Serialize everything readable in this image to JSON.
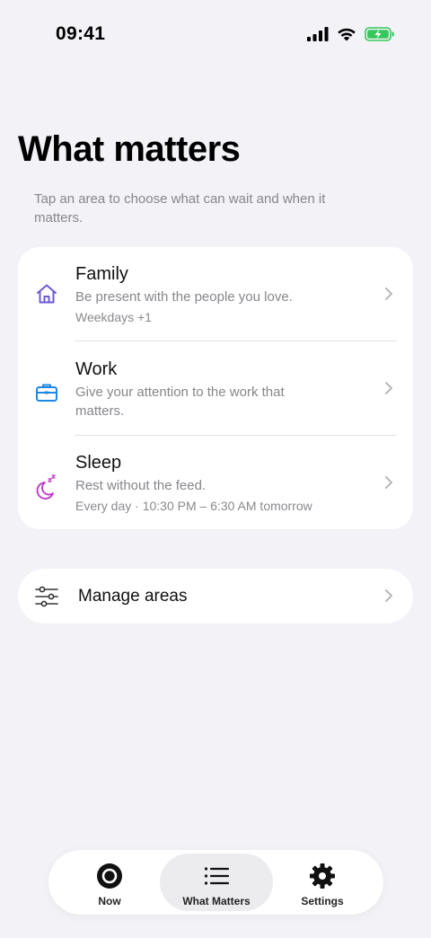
{
  "status_bar": {
    "time": "09:41",
    "icons": [
      "cellular-signal-icon",
      "wifi-icon",
      "battery-charging-icon"
    ],
    "battery_color": "#34c759"
  },
  "header": {
    "title": "What matters",
    "subtitle": "Tap an area to choose what can wait and when it matters."
  },
  "areas": [
    {
      "icon": "home-icon",
      "icon_color": "#6b5bd6",
      "title": "Family",
      "description": "Be present with the people you love.",
      "meta": "Weekdays +1"
    },
    {
      "icon": "briefcase-icon",
      "icon_color": "#1e88e5",
      "title": "Work",
      "description": "Give your attention to the work that matters.",
      "meta": ""
    },
    {
      "icon": "moon-sleep-icon",
      "icon_color": "#c034c8",
      "title": "Sleep",
      "description": "Rest without the feed.",
      "meta": "Every day · 10:30 PM – 6:30 AM tomorrow"
    }
  ],
  "manage": {
    "icon": "sliders-icon",
    "label": "Manage areas"
  },
  "tab_bar": {
    "tabs": [
      {
        "icon": "circle-icon",
        "label": "Now",
        "selected": false
      },
      {
        "icon": "list-icon",
        "label": "What Matters",
        "selected": true
      },
      {
        "icon": "gear-icon",
        "label": "Settings",
        "selected": false
      }
    ]
  },
  "colors": {
    "background": "#f2f2f7",
    "card": "#ffffff",
    "secondary_text": "#86868c",
    "selected_tab": "#ececef"
  }
}
